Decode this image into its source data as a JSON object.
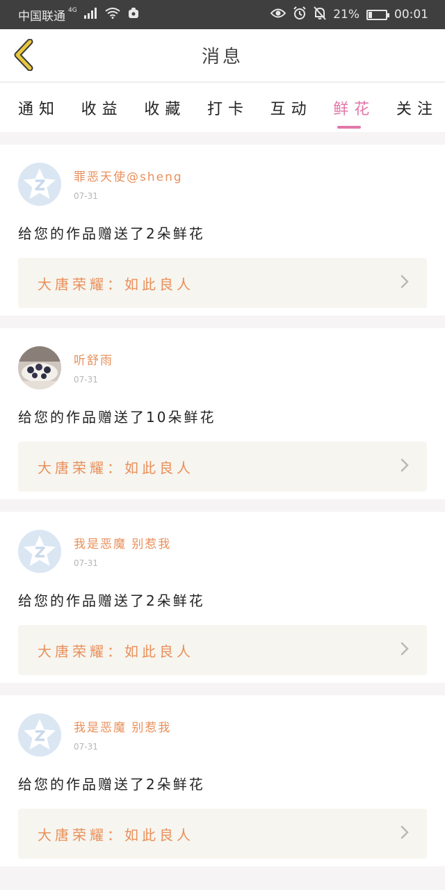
{
  "status_bar": {
    "carrier": "中国联通",
    "network": "4G",
    "battery": "21%",
    "battery_level": 0.21,
    "time": "00:01",
    "icons": [
      "signal-icon",
      "wifi-icon",
      "notification-app-icon",
      "eye-icon",
      "alarm-icon",
      "bell-muted-icon",
      "battery-icon"
    ]
  },
  "header": {
    "title": "消息",
    "back_icon": "chevron-left-icon",
    "back_color": "#e8c73e"
  },
  "tabs": [
    {
      "label": "通知"
    },
    {
      "label": "收益"
    },
    {
      "label": "收藏"
    },
    {
      "label": "打卡"
    },
    {
      "label": "互动"
    },
    {
      "label": "鲜花",
      "active": true
    },
    {
      "label": "关注"
    }
  ],
  "colors": {
    "accent_pink": "#e277a8",
    "accent_orange": "#e98f5a",
    "link_background": "#f6f5ef"
  },
  "messages": [
    {
      "username": "罪恶天使@sheng",
      "date": "07-31",
      "text": "给您的作品赠送了2朵鲜花",
      "work_title": "大唐荣耀：如此良人",
      "avatar": "default-avatar-icon"
    },
    {
      "username": "听舒雨",
      "date": "07-31",
      "text": "给您的作品赠送了10朵鲜花",
      "work_title": "大唐荣耀：如此良人",
      "avatar": "photo-avatar"
    },
    {
      "username": "我是恶魔 别惹我",
      "date": "07-31",
      "text": "给您的作品赠送了2朵鲜花",
      "work_title": "大唐荣耀：如此良人",
      "avatar": "default-avatar-icon"
    },
    {
      "username": "我是恶魔 别惹我",
      "date": "07-31",
      "text": "给您的作品赠送了2朵鲜花",
      "work_title": "大唐荣耀：如此良人",
      "avatar": "default-avatar-icon"
    }
  ]
}
